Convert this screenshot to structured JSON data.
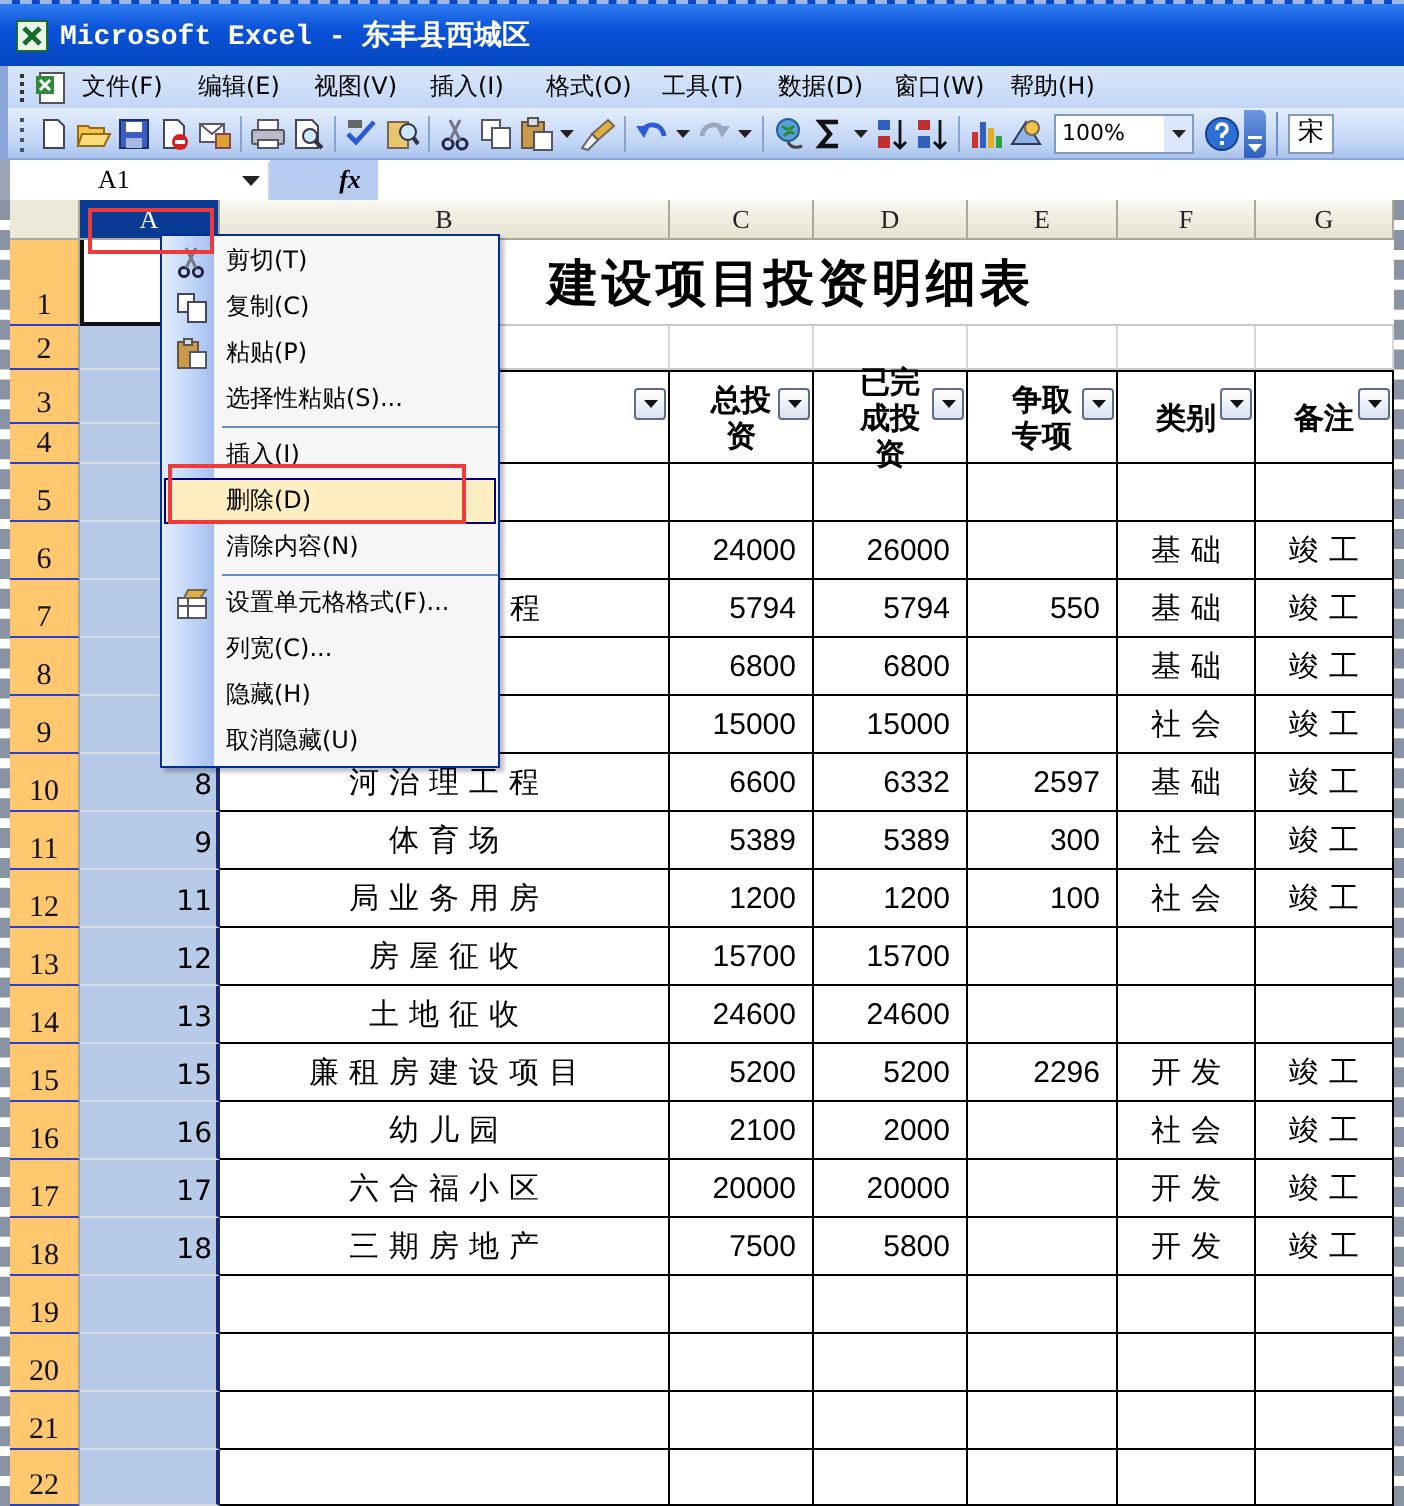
{
  "window": {
    "title": "Microsoft Excel - 东丰县西城区"
  },
  "menu_bar": [
    "文件(F)",
    "编辑(E)",
    "视图(V)",
    "插入(I)",
    "格式(O)",
    "工具(T)",
    "数据(D)",
    "窗口(W)",
    "帮助(H)"
  ],
  "toolbar": {
    "zoom": "100%",
    "font": "宋"
  },
  "formula_bar": {
    "name_box": "A1",
    "function_label": "fx"
  },
  "column_headers": [
    {
      "label": "A",
      "selected": true,
      "highlight": true
    },
    {
      "label": "B",
      "selected": false
    },
    {
      "label": "C",
      "selected": false
    },
    {
      "label": "D",
      "selected": false
    },
    {
      "label": "E",
      "selected": false
    },
    {
      "label": "F",
      "selected": false
    },
    {
      "label": "G",
      "selected": false
    }
  ],
  "sheet": {
    "title": "建设项目投资明细表",
    "header": [
      {
        "filter": true
      },
      {
        "label": "总投资",
        "filter": true
      },
      {
        "label": "已完成投资",
        "filter": true
      },
      {
        "label": "争取专项",
        "filter": true
      },
      {
        "label": "类别",
        "filter": true
      },
      {
        "label": "备注",
        "filter": true
      }
    ],
    "rows": [
      {
        "number": "1"
      },
      {
        "number": "2"
      },
      {
        "number": "3"
      },
      {
        "number": "4"
      },
      {
        "number": "5"
      },
      {
        "number": "6",
        "c": "24000",
        "d": "26000",
        "f": "基础",
        "g": "竣工"
      },
      {
        "number": "7",
        "b": "程",
        "b_cut": true,
        "c": "5794",
        "d": "5794",
        "e": "550",
        "f": "基础",
        "g": "竣工"
      },
      {
        "number": "8",
        "c": "6800",
        "d": "6800",
        "f": "基础",
        "g": "竣工"
      },
      {
        "number": "9",
        "c": "15000",
        "d": "15000",
        "f": "社会",
        "g": "竣工"
      },
      {
        "number": "10",
        "a": "8",
        "b": "河治理工程",
        "c": "6600",
        "d": "6332",
        "e": "2597",
        "f": "基础",
        "g": "竣工"
      },
      {
        "number": "11",
        "a": "9",
        "b": "体育场",
        "c": "5389",
        "d": "5389",
        "e": "300",
        "f": "社会",
        "g": "竣工"
      },
      {
        "number": "12",
        "a": "11",
        "b": "局业务用房",
        "c": "1200",
        "d": "1200",
        "e": "100",
        "f": "社会",
        "g": "竣工"
      },
      {
        "number": "13",
        "a": "12",
        "b": "房屋征收",
        "c": "15700",
        "d": "15700"
      },
      {
        "number": "14",
        "a": "13",
        "b": "土地征收",
        "c": "24600",
        "d": "24600"
      },
      {
        "number": "15",
        "a": "15",
        "b": "廉租房建设项目",
        "c": "5200",
        "d": "5200",
        "e": "2296",
        "f": "开发",
        "g": "竣工"
      },
      {
        "number": "16",
        "a": "16",
        "b": "幼儿园",
        "c": "2100",
        "d": "2000",
        "f": "社会",
        "g": "竣工"
      },
      {
        "number": "17",
        "a": "17",
        "b": "六合福小区",
        "c": "20000",
        "d": "20000",
        "f": "开发",
        "g": "竣工"
      },
      {
        "number": "18",
        "a": "18",
        "b": "三期房地产",
        "c": "7500",
        "d": "5800",
        "f": "开发",
        "g": "竣工"
      },
      {
        "number": "19"
      },
      {
        "number": "20"
      },
      {
        "number": "21"
      },
      {
        "number": "22"
      }
    ]
  },
  "context_menu": {
    "items": [
      {
        "kind": "item",
        "label": "剪切(T)",
        "selected": false
      },
      {
        "kind": "item",
        "label": "复制(C)",
        "selected": false
      },
      {
        "kind": "item",
        "label": "粘贴(P)",
        "selected": false
      },
      {
        "kind": "item",
        "label": "选择性粘贴(S)...",
        "selected": false
      },
      {
        "kind": "separator"
      },
      {
        "kind": "item",
        "label": "插入(I)",
        "selected": false
      },
      {
        "kind": "item",
        "label": "删除(D)",
        "selected": true,
        "highlight": true
      },
      {
        "kind": "item",
        "label": "清除内容(N)",
        "selected": false
      },
      {
        "kind": "separator"
      },
      {
        "kind": "item",
        "label": "设置单元格格式(F)...",
        "selected": false
      },
      {
        "kind": "item",
        "label": "列宽(C)...",
        "selected": false
      },
      {
        "kind": "item",
        "label": "隐藏(H)",
        "selected": false
      },
      {
        "kind": "item",
        "label": "取消隐藏(U)",
        "selected": false
      }
    ]
  }
}
